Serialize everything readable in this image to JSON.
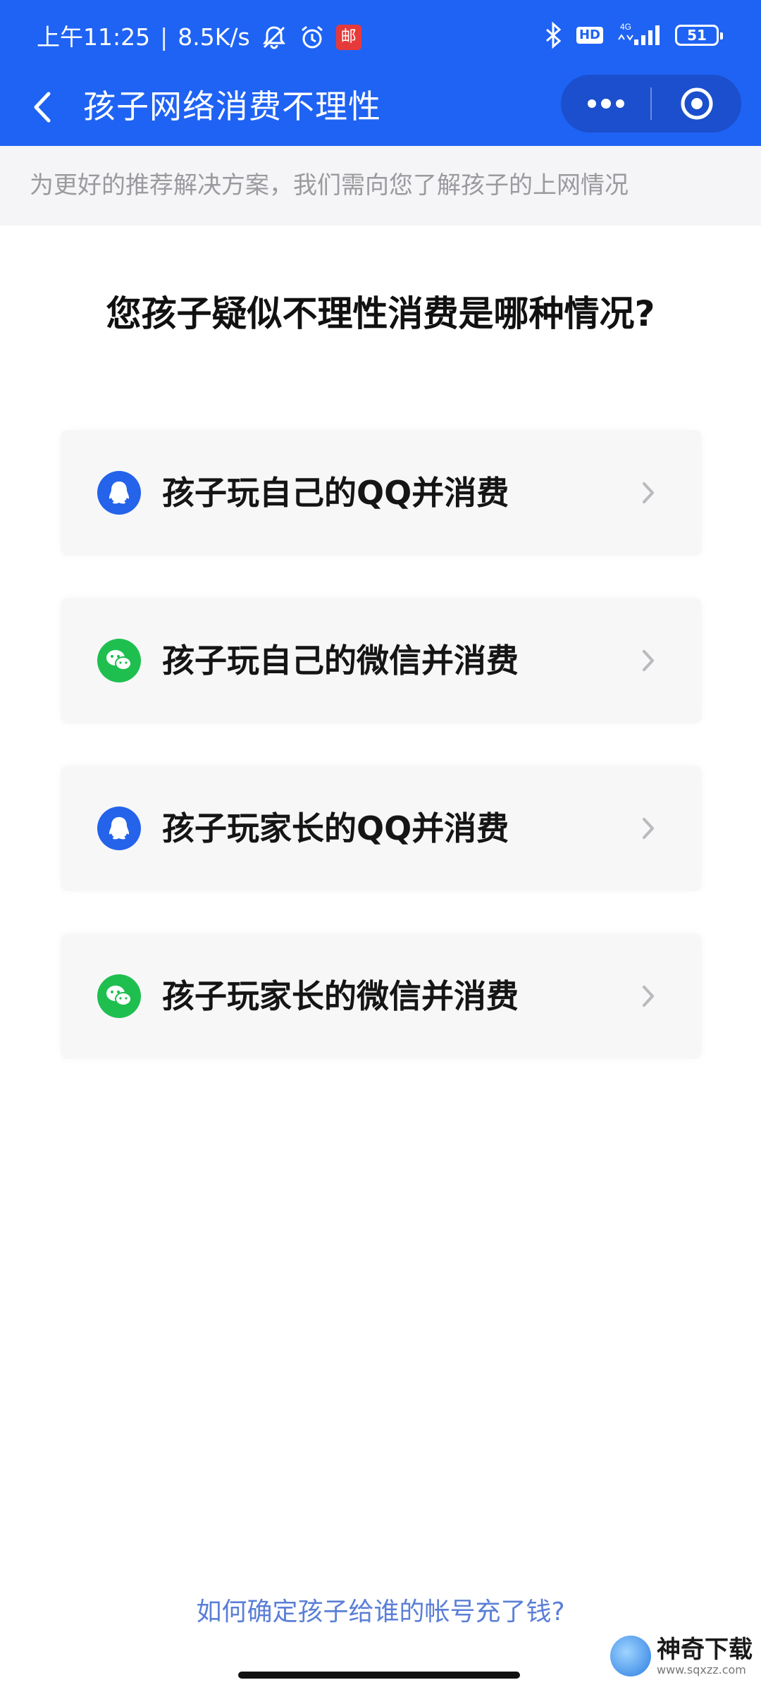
{
  "status_bar": {
    "time": "上午11:25",
    "separator": "|",
    "network_speed": "8.5K/s",
    "mail_badge": "邮",
    "hd_label": "HD",
    "network_type": "4G",
    "battery_level": "51",
    "icons": [
      "bell-off-icon",
      "alarm-icon",
      "mail-badge-icon",
      "bluetooth-icon",
      "signal-icon",
      "battery-icon"
    ]
  },
  "nav": {
    "title": "孩子网络消费不理性",
    "back_icon": "chevron-left-icon",
    "more_icon": "more-dots-icon",
    "close_icon": "target-circle-icon"
  },
  "subtitle": "为更好的推荐解决方案，我们需向您了解孩子的上网情况",
  "question": "您孩子疑似不理性消费是哪种情况?",
  "options": [
    {
      "label": "孩子玩自己的QQ并消费",
      "icon": "qq-icon"
    },
    {
      "label": "孩子玩自己的微信并消费",
      "icon": "wechat-icon"
    },
    {
      "label": "孩子玩家长的QQ并消费",
      "icon": "qq-icon"
    },
    {
      "label": "孩子玩家长的微信并消费",
      "icon": "wechat-icon"
    }
  ],
  "help_link": "如何确定孩子给谁的帐号充了钱?",
  "watermark": {
    "title": "神奇下载",
    "url": "www.sqxzz.com"
  },
  "colors": {
    "header_blue": "#1f63f4",
    "qq_blue": "#2463ea",
    "wechat_green": "#1fbf4f",
    "link_blue": "#5b7fd6"
  }
}
